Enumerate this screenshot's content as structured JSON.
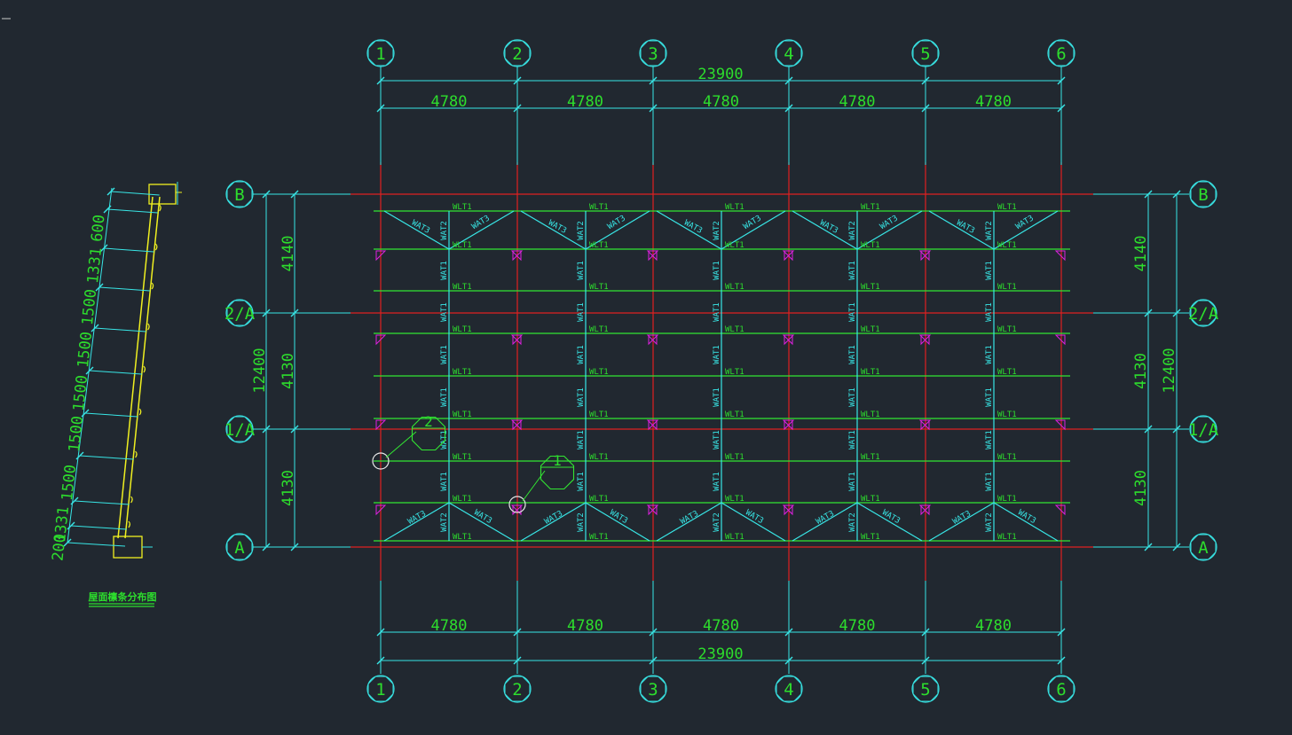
{
  "plan": {
    "column_axes": [
      "1",
      "2",
      "3",
      "4",
      "5",
      "6"
    ],
    "row_axes": [
      "A",
      "1/A",
      "2/A",
      "B"
    ],
    "overall_width": "23900",
    "bay_widths": [
      "4780",
      "4780",
      "4780",
      "4780",
      "4780"
    ],
    "overall_depth": "12400",
    "row_spacings": [
      "4130",
      "4130",
      "4140"
    ],
    "member_labels": {
      "purlin": "WLT1",
      "tie_rod": "WAT1",
      "strut": "WAT2",
      "diagonal": "WAT3"
    },
    "detail_callouts": [
      "1",
      "2"
    ]
  },
  "section": {
    "dimensions": [
      "200",
      "1331",
      "1500",
      "1500",
      "1500",
      "1500",
      "1500",
      "1331",
      "600"
    ],
    "title": "屋面檩条分布图"
  },
  "colors": {
    "background": "#212830",
    "grid_line": "#e02020",
    "dimension": "#38e6e6",
    "text": "#2dde2d",
    "beam": "#32e632",
    "marker": "#e020e0",
    "rafter": "#f0f020"
  }
}
